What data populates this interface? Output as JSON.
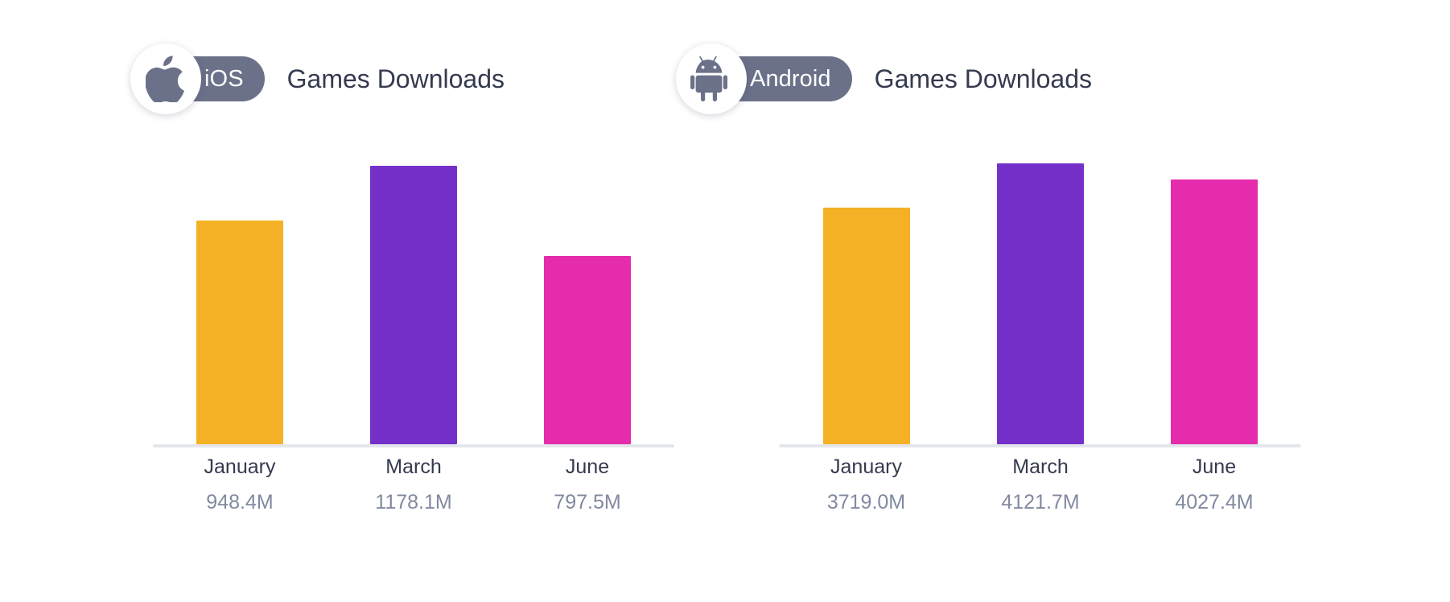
{
  "page": {
    "background": "#ffffff"
  },
  "colors": {
    "bar_january": "#f5b125",
    "bar_march": "#7630ca",
    "bar_june": "#e52cac",
    "badge_pill": "#6b7189",
    "badge_circle": "#ffffff",
    "title_text": "#343b4f",
    "value_text": "#8189a0",
    "axis_line": "#e3e7ec"
  },
  "panels": [
    {
      "key": "ios",
      "badge": {
        "icon": "apple-logo-icon",
        "label": "iOS"
      },
      "title": "Games Downloads",
      "chart_data": {
        "type": "bar",
        "title": "iOS Games Downloads",
        "xlabel": "",
        "ylabel": "",
        "grid": false,
        "legend": "none",
        "ylim": [
          0,
          1300
        ],
        "categories": [
          "January",
          "March",
          "June"
        ],
        "values": [
          948.4,
          1178.1,
          797.5
        ],
        "value_labels": [
          "948.4M",
          "1178.1M",
          "797.5M"
        ],
        "unit": "M",
        "colors": [
          "#f5b125",
          "#7630ca",
          "#e52cac"
        ]
      }
    },
    {
      "key": "android",
      "badge": {
        "icon": "android-robot-icon",
        "label": "Android"
      },
      "title": "Games Downloads",
      "chart_data": {
        "type": "bar",
        "title": "Android Games Downloads",
        "xlabel": "",
        "ylabel": "",
        "grid": false,
        "legend": "none",
        "ylim": [
          0,
          4550
        ],
        "categories": [
          "January",
          "March",
          "June"
        ],
        "values": [
          3719.0,
          4121.7,
          4027.4
        ],
        "value_labels": [
          "3719.0M",
          "4121.7M",
          "4027.4M"
        ],
        "unit": "M",
        "colors": [
          "#f5b125",
          "#7630ca",
          "#e52cac"
        ]
      }
    }
  ],
  "chart_data": [
    {
      "type": "bar",
      "title": "iOS Games Downloads",
      "categories": [
        "January",
        "March",
        "June"
      ],
      "values": [
        948.4,
        1178.1,
        797.5
      ],
      "value_labels": [
        "948.4M",
        "1178.1M",
        "797.5M"
      ],
      "unit": "M",
      "ylim": [
        0,
        1300
      ],
      "grid": false,
      "legend": "none",
      "colors": [
        "#f5b125",
        "#7630ca",
        "#e52cac"
      ]
    },
    {
      "type": "bar",
      "title": "Android Games Downloads",
      "categories": [
        "January",
        "March",
        "June"
      ],
      "values": [
        3719.0,
        4121.7,
        4027.4
      ],
      "value_labels": [
        "3719.0M",
        "4121.7M",
        "4027.4M"
      ],
      "unit": "M",
      "ylim": [
        0,
        4550
      ],
      "grid": false,
      "legend": "none",
      "colors": [
        "#f5b125",
        "#7630ca",
        "#e52cac"
      ]
    }
  ]
}
